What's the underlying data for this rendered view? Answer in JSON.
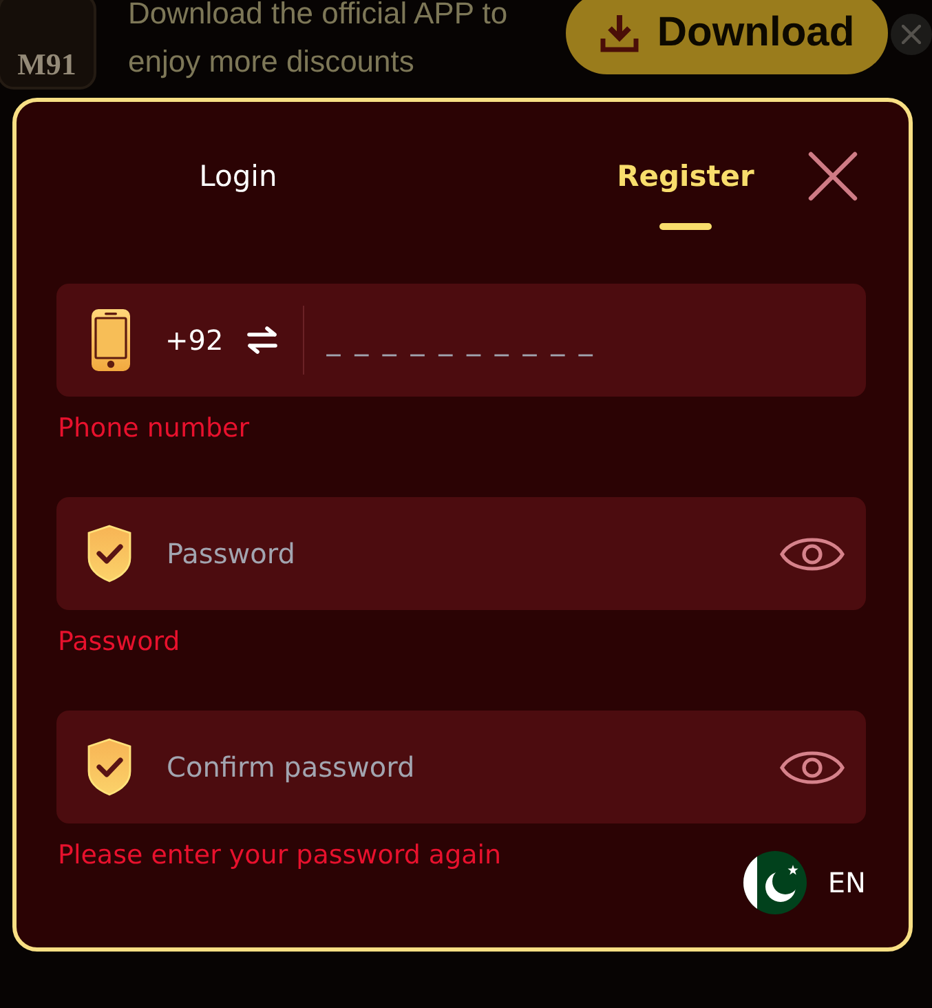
{
  "banner": {
    "logo": "M91",
    "message": "Download the official APP to enjoy more discounts",
    "download_button": "Download"
  },
  "dialog": {
    "tabs": [
      {
        "label": "Login",
        "selected": false
      },
      {
        "label": "Register",
        "selected": true
      }
    ],
    "fields": [
      {
        "kind": "phone",
        "country_code": "+92",
        "placeholder": "_ _ _ _ _ _ _ _ _ _",
        "hint": "Phone number"
      },
      {
        "kind": "password",
        "placeholder": "Password",
        "hint": "Password"
      },
      {
        "kind": "password",
        "placeholder": "Confirm password",
        "hint": "Please enter your password again"
      }
    ],
    "language": {
      "code": "EN"
    }
  }
}
